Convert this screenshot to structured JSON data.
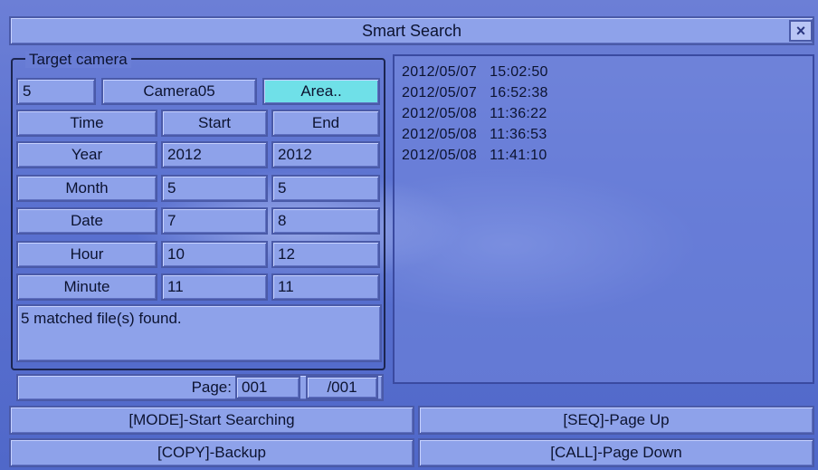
{
  "window": {
    "title": "Smart Search",
    "close_glyph": "×"
  },
  "target": {
    "label": "Target camera",
    "number": "5",
    "name": "Camera05",
    "area_button": "Area.."
  },
  "table": {
    "headers": {
      "time": "Time",
      "start": "Start",
      "end": "End"
    },
    "rows": [
      {
        "label": "Year",
        "start": "2012",
        "end": "2012"
      },
      {
        "label": "Month",
        "start": "5",
        "end": "5"
      },
      {
        "label": "Date",
        "start": "7",
        "end": "8"
      },
      {
        "label": "Hour",
        "start": "10",
        "end": "12"
      },
      {
        "label": "Minute",
        "start": "11",
        "end": "11"
      }
    ]
  },
  "status": "5 matched file(s) found.",
  "page": {
    "label": "Page:",
    "current": "001",
    "total": "/001"
  },
  "results": [
    {
      "date": "2012/05/07",
      "time": "15:02:50"
    },
    {
      "date": "2012/05/07",
      "time": "16:52:38"
    },
    {
      "date": "2012/05/08",
      "time": "11:36:22"
    },
    {
      "date": "2012/05/08",
      "time": "11:36:53"
    },
    {
      "date": "2012/05/08",
      "time": "11:41:10"
    }
  ],
  "buttons": {
    "mode": "[MODE]-Start Searching",
    "seq": "[SEQ]-Page Up",
    "copy": "[COPY]-Backup",
    "call": "[CALL]-Page Down"
  },
  "colors": {
    "background": "#5a71d0",
    "cell": "#8ea2ea",
    "area_button": "#6fe0e8",
    "text": "#0c1330"
  }
}
